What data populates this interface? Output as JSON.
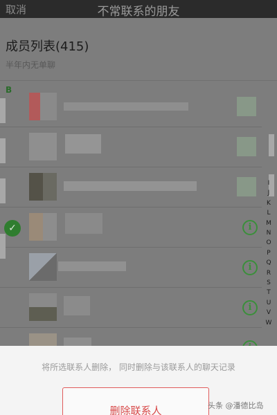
{
  "nav": {
    "cancel_label": "取消",
    "title": "不常联系的朋友"
  },
  "list": {
    "header": "成员列表(415)",
    "subtitle": "半年内无单聊",
    "section_letter": "B"
  },
  "rows": [
    {
      "selected": false,
      "has_info": false
    },
    {
      "selected": false,
      "has_info": false
    },
    {
      "selected": false,
      "has_info": false
    },
    {
      "selected": true,
      "has_info": true
    },
    {
      "selected": false,
      "has_info": true
    },
    {
      "selected": false,
      "has_info": true
    },
    {
      "selected": false,
      "has_info": true
    }
  ],
  "alphabet": [
    "I",
    "J",
    "K",
    "L",
    "M",
    "N",
    "O",
    "P",
    "Q",
    "R",
    "S",
    "T",
    "U",
    "V",
    "W"
  ],
  "sheet": {
    "note": "将所选联系人删除， 同时删除与该联系人的聊天记录",
    "delete_label": "删除联系人"
  },
  "watermark": {
    "text": "头条 @潘德比岛"
  },
  "colors": {
    "accent_green": "#2f7d2f",
    "danger_red": "#d84a4a",
    "navbar": "#2b2b2b"
  }
}
